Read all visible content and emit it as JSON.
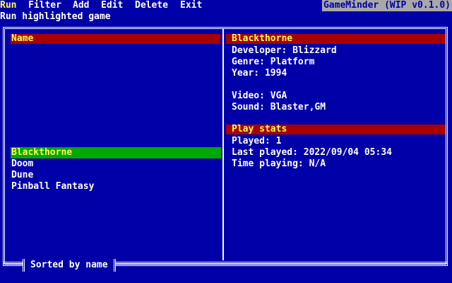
{
  "menubar": {
    "items": [
      "Run",
      "Filter",
      "Add",
      "Edit",
      "Delete",
      "Exit"
    ],
    "active_item": "Run",
    "app_title": "GameMinder (WIP v0.1.0)"
  },
  "hint": "Run highlighted game",
  "list": {
    "header": "Name",
    "items": [
      "Blackthorne",
      "Doom",
      "Dune",
      "Pinball Fantasy"
    ],
    "selected": "Blackthorne"
  },
  "details": {
    "title": "Blackthorne",
    "developer": "Developer: Blizzard",
    "genre": "Genre: Platform",
    "year": "Year: 1994",
    "video": "Video: VGA",
    "sound": "Sound: Blaster,GM"
  },
  "stats": {
    "header": "Play stats",
    "played": "Played: 1",
    "last_played": "Last played: 2022/09/04 05:34",
    "time_playing": "Time playing: N/A"
  },
  "status": {
    "sort": "Sorted by name"
  },
  "colors": {
    "background": "#0000a8",
    "header": "#a80000",
    "header_text": "#ffff55",
    "selection": "#00a800",
    "title_bg": "#a8a8a8"
  }
}
